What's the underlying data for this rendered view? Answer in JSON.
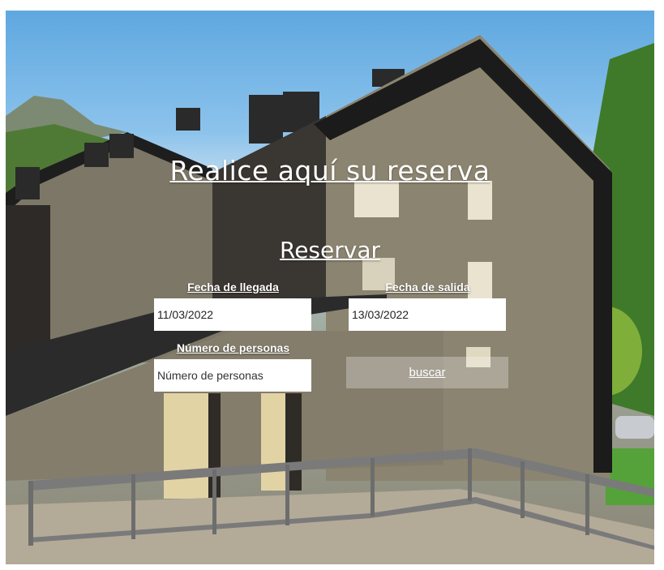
{
  "page": {
    "title": "Realice aquí su reserva",
    "section_title": "Reservar"
  },
  "form": {
    "arrival_label": "Fecha de llegada",
    "arrival_value": "11/03/2022",
    "departure_label": "Fecha de salida",
    "departure_value": "13/03/2022",
    "people_label": "Número de personas",
    "people_placeholder": "Número de personas",
    "search_label": "buscar"
  },
  "colors": {
    "text": "#ffffff",
    "field_bg": "#ffffff",
    "roof": "#1c1c1c",
    "stone": "#8c8573",
    "sky": "#6fb0e2"
  }
}
